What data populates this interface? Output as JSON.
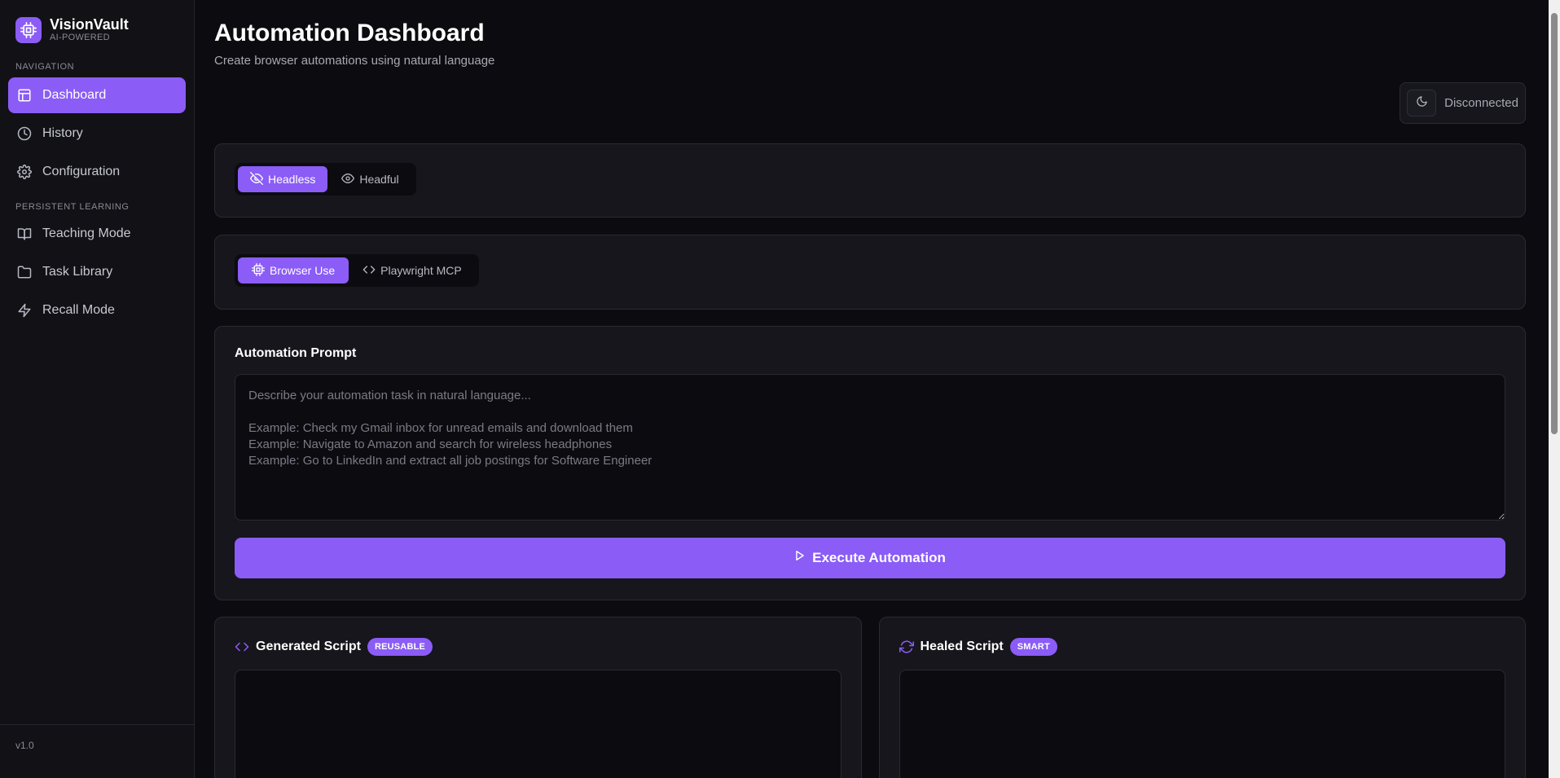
{
  "brand": {
    "name": "VisionVault",
    "subtitle": "AI-POWERED",
    "icon": "cpu-icon"
  },
  "sidebar": {
    "navigation_label": "NAVIGATION",
    "nav_items": [
      {
        "label": "Dashboard",
        "icon": "dashboard-icon",
        "active": true
      },
      {
        "label": "History",
        "icon": "clock-icon",
        "active": false
      },
      {
        "label": "Configuration",
        "icon": "gear-icon",
        "active": false
      }
    ],
    "learning_label": "PERSISTENT LEARNING",
    "learning_items": [
      {
        "label": "Teaching Mode",
        "icon": "book-icon"
      },
      {
        "label": "Task Library",
        "icon": "folder-icon"
      },
      {
        "label": "Recall Mode",
        "icon": "zap-icon"
      }
    ],
    "version": "v1.0"
  },
  "header": {
    "title": "Automation Dashboard",
    "subtitle": "Create browser automations using natural language",
    "status": "Disconnected"
  },
  "mode_toggle": {
    "options": [
      "Headless",
      "Headful"
    ],
    "selected": "Headless"
  },
  "engine_toggle": {
    "options": [
      "Browser Use",
      "Playwright MCP"
    ],
    "selected": "Browser Use"
  },
  "prompt": {
    "label": "Automation Prompt",
    "value": "",
    "placeholder": "Describe your automation task in natural language...\n\nExample: Check my Gmail inbox for unread emails and download them\nExample: Navigate to Amazon and search for wireless headphones\nExample: Go to LinkedIn and extract all job postings for Software Engineer",
    "execute_label": "Execute Automation"
  },
  "scripts": {
    "generated": {
      "title": "Generated Script",
      "badge": "REUSABLE"
    },
    "healed": {
      "title": "Healed Script",
      "badge": "SMART"
    }
  },
  "colors": {
    "accent": "#8b5cf6",
    "background": "#0c0c10",
    "card": "#16161c",
    "sidebar": "#111116"
  }
}
